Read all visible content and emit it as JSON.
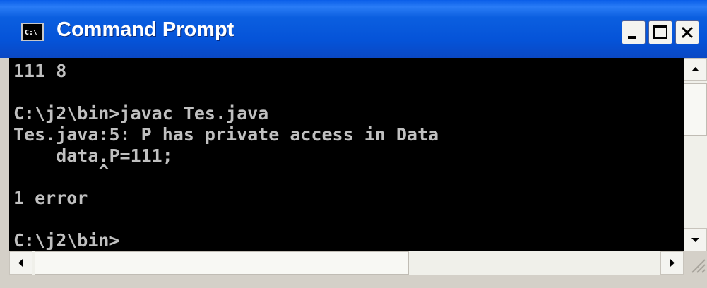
{
  "window": {
    "title": "Command Prompt",
    "app_icon_label": "C:\\",
    "icons": {
      "minimize": "minimize-icon",
      "maximize": "maximize-icon",
      "close": "close-icon"
    },
    "colors": {
      "titlebar": "#0553d8",
      "console_bg": "#000000",
      "console_text": "#c0c0c0"
    }
  },
  "console": {
    "lines": [
      "111 8",
      "",
      "C:\\j2\\bin>javac Tes.java",
      "Tes.java:5: P has private access in Data",
      "    data.P=111;",
      "        ^",
      "1 error",
      "",
      "C:\\j2\\bin>"
    ]
  },
  "scrollbars": {
    "vertical": [
      "scroll-up-arrow",
      "scroll-down-arrow"
    ],
    "horizontal": [
      "scroll-left-arrow",
      "scroll-right-arrow"
    ]
  }
}
